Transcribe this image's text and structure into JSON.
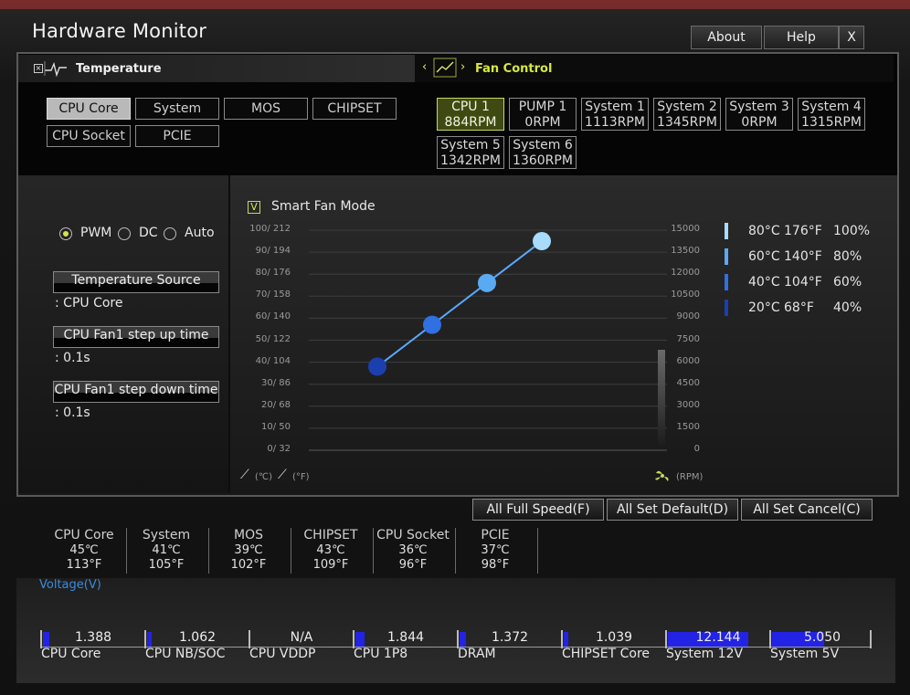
{
  "window": {
    "title": "Hardware Monitor",
    "about": "About",
    "help": "Help",
    "close": "X"
  },
  "temperature": {
    "header": "Temperature",
    "sources": [
      "CPU Core",
      "System",
      "MOS",
      "CHIPSET",
      "CPU Socket",
      "PCIE"
    ],
    "selected": "CPU Core"
  },
  "fan_control": {
    "header": "Fan Control",
    "fans": [
      {
        "name": "CPU 1",
        "rpm": "884RPM"
      },
      {
        "name": "PUMP 1",
        "rpm": "0RPM"
      },
      {
        "name": "System 1",
        "rpm": "1113RPM"
      },
      {
        "name": "System 2",
        "rpm": "1345RPM"
      },
      {
        "name": "System 3",
        "rpm": "0RPM"
      },
      {
        "name": "System 4",
        "rpm": "1315RPM"
      },
      {
        "name": "System 5",
        "rpm": "1342RPM"
      },
      {
        "name": "System 6",
        "rpm": "1360RPM"
      }
    ],
    "selected": "CPU 1"
  },
  "settings": {
    "modes": [
      "PWM",
      "DC",
      "Auto"
    ],
    "mode_selected": "PWM",
    "temp_source_label": "Temperature Source",
    "temp_source_value": ": CPU Core",
    "step_up_label": "CPU Fan1 step up time",
    "step_up_value": ": 0.1s",
    "step_down_label": "CPU Fan1 step down time",
    "step_down_value": ": 0.1s"
  },
  "graph": {
    "smart_fan_label": "Smart Fan Mode",
    "smart_fan_check": "V",
    "y_left_ticks": [
      "100/ 212",
      "90/ 194",
      "80/ 176",
      "70/ 158",
      "60/ 140",
      "50/ 122",
      "40/ 104",
      "30/  86",
      "20/  68",
      "10/  50",
      "0/  32"
    ],
    "y_right_ticks": [
      "15000",
      "13500",
      "12000",
      "10500",
      "9000",
      "7500",
      "6000",
      "4500",
      "3000",
      "1500",
      "0"
    ],
    "unit_c": "(℃)",
    "unit_f": "(°F)",
    "unit_rpm": "(RPM)",
    "accent": "#3a7fe6"
  },
  "curve": [
    {
      "temp_c": 80,
      "temp_f": "176°F",
      "temp_c_label": "80°C",
      "pct": "100%",
      "color": "#a8dcff"
    },
    {
      "temp_c": 60,
      "temp_f": "140°F",
      "temp_c_label": "60°C",
      "pct": "80%",
      "color": "#59aaf2"
    },
    {
      "temp_c": 40,
      "temp_f": "104°F",
      "temp_c_label": "40°C",
      "pct": "60%",
      "color": "#3070e0"
    },
    {
      "temp_c": 20,
      "temp_f": "68°F",
      "temp_c_label": "20°C",
      "pct": "40%",
      "color": "#1c3fb0"
    }
  ],
  "actions": {
    "full_speed": "All Full Speed(F)",
    "set_default": "All Set Default(D)",
    "set_cancel": "All Set Cancel(C)"
  },
  "readings": [
    {
      "name": "CPU Core",
      "c": "45℃",
      "f": "113°F"
    },
    {
      "name": "System",
      "c": "41℃",
      "f": "105°F"
    },
    {
      "name": "MOS",
      "c": "39℃",
      "f": "102°F"
    },
    {
      "name": "CHIPSET",
      "c": "43℃",
      "f": "109°F"
    },
    {
      "name": "CPU Socket",
      "c": "36℃",
      "f": "96°F"
    },
    {
      "name": "PCIE",
      "c": "37℃",
      "f": "98°F"
    }
  ],
  "voltage": {
    "title": "Voltage(V)",
    "items": [
      {
        "name": "CPU Core",
        "value": "1.388",
        "level": 0.07
      },
      {
        "name": "CPU NB/SOC",
        "value": "1.062",
        "level": 0.05
      },
      {
        "name": "CPU VDDP",
        "value": "N/A",
        "level": 0
      },
      {
        "name": "CPU 1P8",
        "value": "1.844",
        "level": 0.1
      },
      {
        "name": "DRAM",
        "value": "1.372",
        "level": 0.07
      },
      {
        "name": "CHIPSET Core",
        "value": "1.039",
        "level": 0.05
      },
      {
        "name": "System 12V",
        "value": "12.144",
        "level": 0.85
      },
      {
        "name": "System 5V",
        "value": "5.050",
        "level": 0.55
      }
    ]
  }
}
